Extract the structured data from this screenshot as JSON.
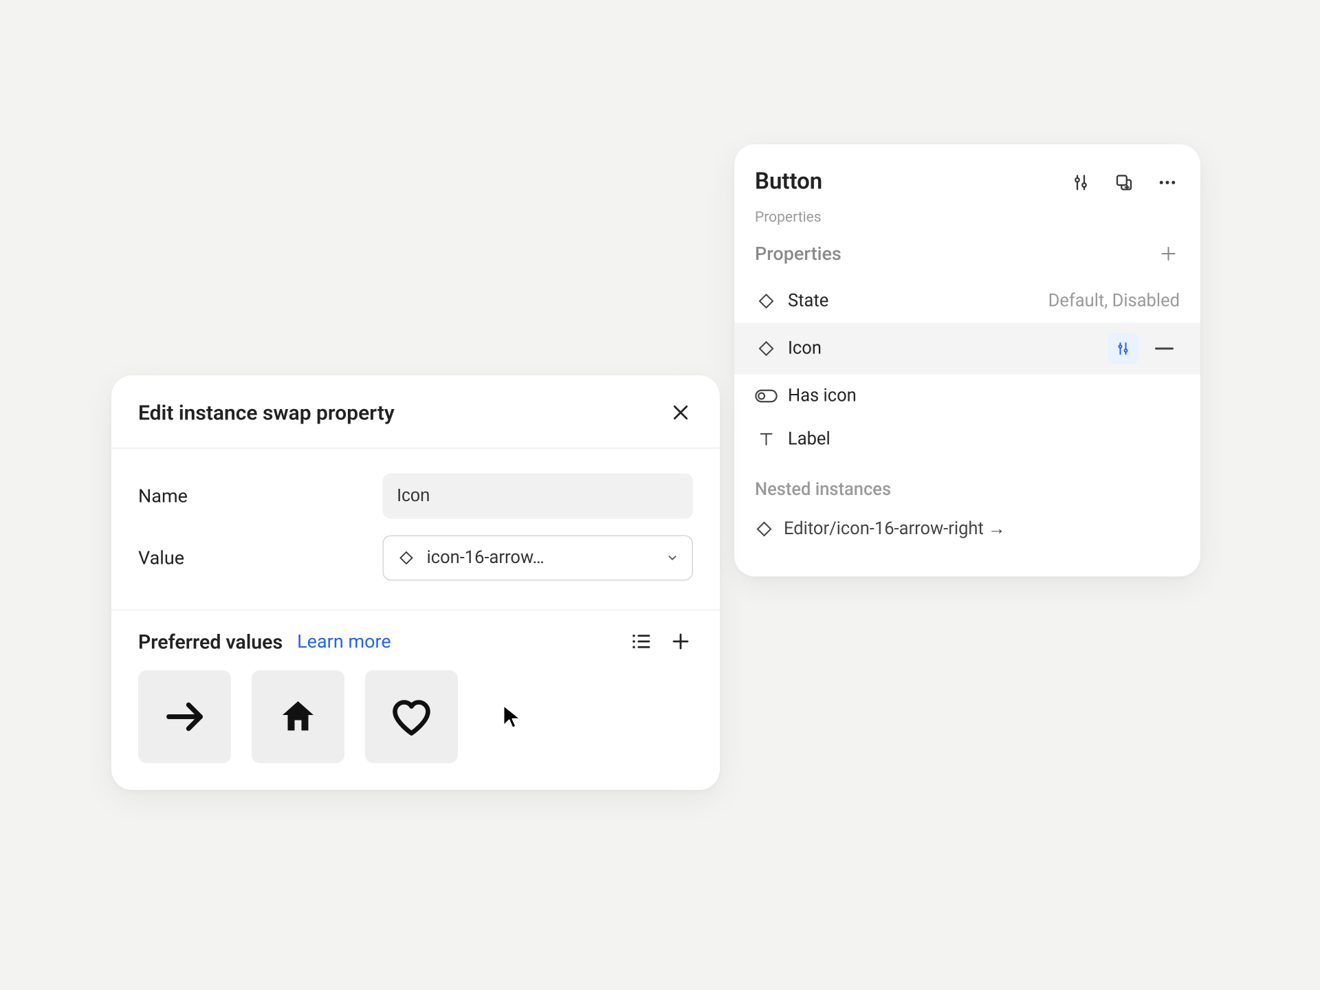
{
  "right_panel": {
    "title": "Button",
    "subtitle": "Properties",
    "section_label": "Properties",
    "props": [
      {
        "name": "State",
        "value": "Default, Disabled",
        "type": "variant"
      },
      {
        "name": "Icon",
        "value": "",
        "type": "variant",
        "selected": true
      },
      {
        "name": "Has icon",
        "value": "",
        "type": "boolean"
      },
      {
        "name": "Label",
        "value": "",
        "type": "text"
      }
    ],
    "nested_label": "Nested instances",
    "nested_item": "Editor/icon-16-arrow-right →"
  },
  "dialog": {
    "title": "Edit instance swap property",
    "name_label": "Name",
    "name_value": "Icon",
    "value_label": "Value",
    "value_value": "icon-16-arrow…",
    "preferred_label": "Preferred values",
    "learn_more": "Learn more",
    "preferred_icons": [
      "arrow-right",
      "home",
      "heart"
    ]
  }
}
